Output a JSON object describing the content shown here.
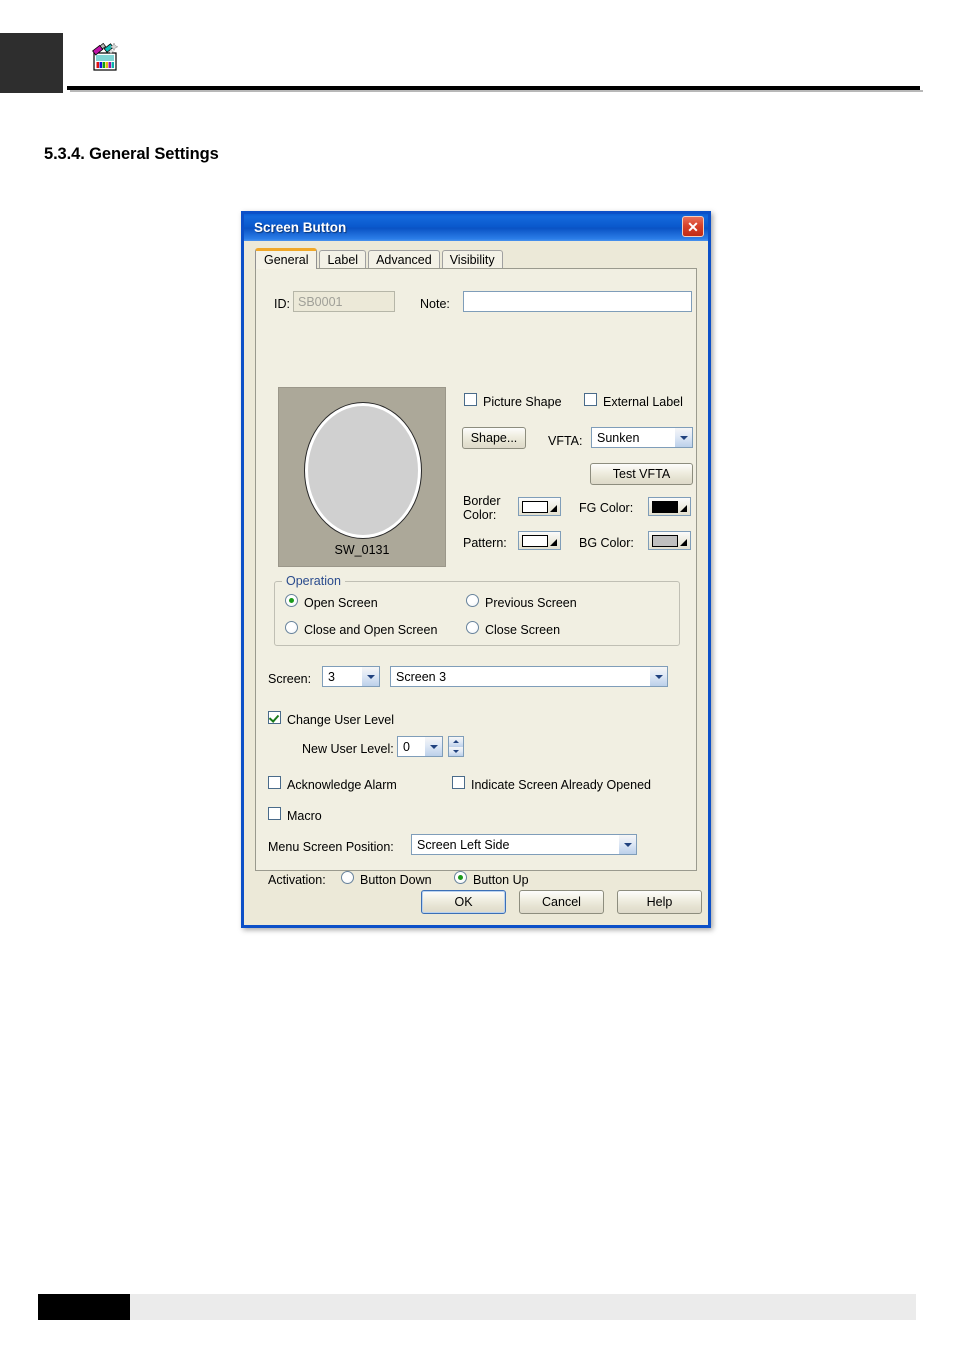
{
  "page": {
    "heading": "5.3.4. General Settings",
    "header_icon": "screen-editor-icon"
  },
  "dialog": {
    "title": "Screen Button",
    "close_label": "✕",
    "tabs": [
      {
        "label": "General",
        "active": true
      },
      {
        "label": "Label",
        "active": false
      },
      {
        "label": "Advanced",
        "active": false
      },
      {
        "label": "Visibility",
        "active": false
      }
    ],
    "id_field": {
      "label": "ID:",
      "value": "SB0001",
      "disabled": true
    },
    "note_field": {
      "label": "Note:",
      "value": "",
      "placeholder": ""
    },
    "preview": {
      "shape_label": "SW_0131",
      "background": "#ACA899",
      "fill": "#D0D0D0"
    },
    "picture_shape": {
      "label": "Picture Shape",
      "checked": false
    },
    "external_label": {
      "label": "External Label",
      "checked": false
    },
    "shape_button": "Shape...",
    "vfta": {
      "label": "VFTA:",
      "value": "Sunken"
    },
    "test_vfta_button": "Test VFTA",
    "border_color": {
      "label": "Border Color:",
      "color": "#FFFFFF"
    },
    "fg_color": {
      "label": "FG Color:",
      "color": "#000000"
    },
    "pattern": {
      "label": "Pattern:",
      "color": "#FFFFFF"
    },
    "bg_color": {
      "label": "BG Color:",
      "color": "#BFBFBF"
    },
    "operation": {
      "legend": "Operation",
      "options": [
        {
          "label": "Open Screen",
          "checked": true
        },
        {
          "label": "Previous Screen",
          "checked": false
        },
        {
          "label": "Close and Open Screen",
          "checked": false
        },
        {
          "label": "Close Screen",
          "checked": false
        }
      ]
    },
    "screen": {
      "label": "Screen:",
      "number": "3",
      "name": "Screen 3"
    },
    "change_user_level": {
      "label": "Change User Level",
      "checked": true
    },
    "new_user_level": {
      "label": "New User Level:",
      "value": "0"
    },
    "acknowledge_alarm": {
      "label": "Acknowledge Alarm",
      "checked": false
    },
    "indicate_screen_already_opened": {
      "label": "Indicate Screen Already Opened",
      "checked": false
    },
    "macro": {
      "label": "Macro",
      "checked": false
    },
    "menu_screen_position": {
      "label": "Menu Screen Position:",
      "value": "Screen Left Side"
    },
    "activation": {
      "label": "Activation:",
      "options": [
        {
          "label": "Button Down",
          "checked": false
        },
        {
          "label": "Button Up",
          "checked": true
        }
      ]
    },
    "buttons": {
      "ok": "OK",
      "cancel": "Cancel",
      "help": "Help"
    }
  }
}
